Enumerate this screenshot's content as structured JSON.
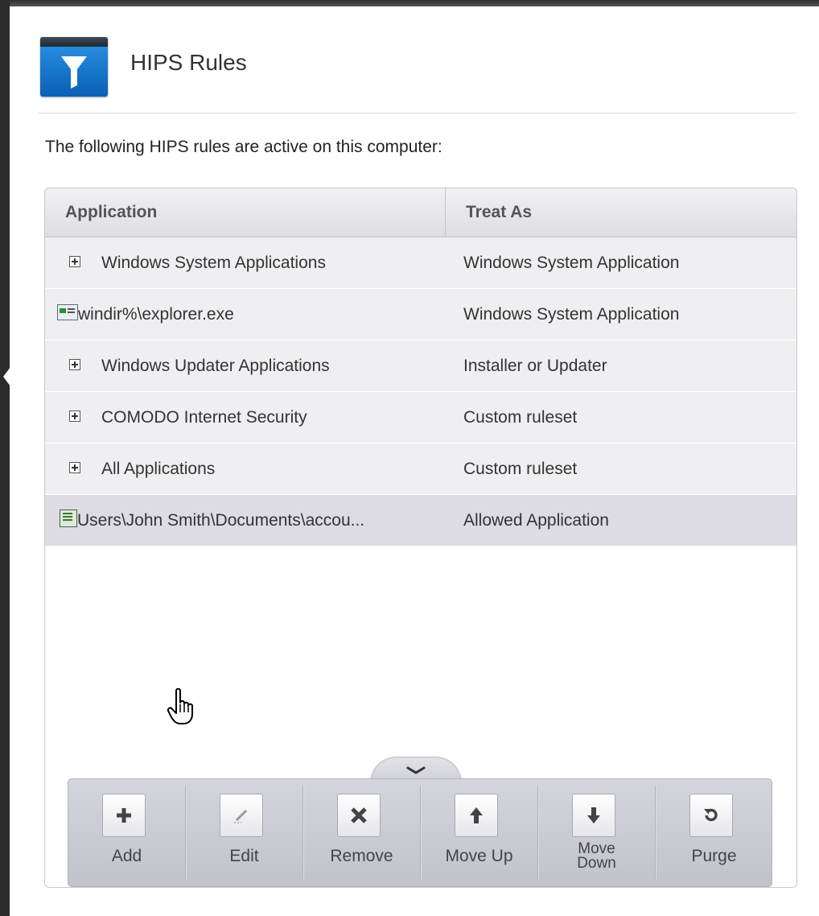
{
  "header": {
    "title": "HIPS Rules",
    "icon": "hips-rules-filter-icon"
  },
  "intro_text": "The following HIPS rules are active on this computer:",
  "table": {
    "columns": [
      "Application",
      "Treat As"
    ],
    "rows": [
      {
        "application": "Windows System Applications",
        "treat_as": "Windows System Application",
        "type": "group"
      },
      {
        "application": "windir%\\explorer.exe",
        "treat_as": "Windows System Application",
        "type": "file"
      },
      {
        "application": "Windows Updater Applications",
        "treat_as": "Installer or Updater",
        "type": "group"
      },
      {
        "application": "COMODO Internet Security",
        "treat_as": "Custom ruleset",
        "type": "group"
      },
      {
        "application": "All Applications",
        "treat_as": "Custom ruleset",
        "type": "group"
      },
      {
        "application": "Users\\John Smith\\Documents\\accou...",
        "treat_as": "Allowed Application",
        "type": "file",
        "selected": true
      }
    ]
  },
  "toolbar": {
    "add_label": "Add",
    "edit_label": "Edit",
    "remove_label": "Remove",
    "move_up_label": "Move Up",
    "move_down_line1": "Move",
    "move_down_line2": "Down",
    "purge_label": "Purge"
  }
}
